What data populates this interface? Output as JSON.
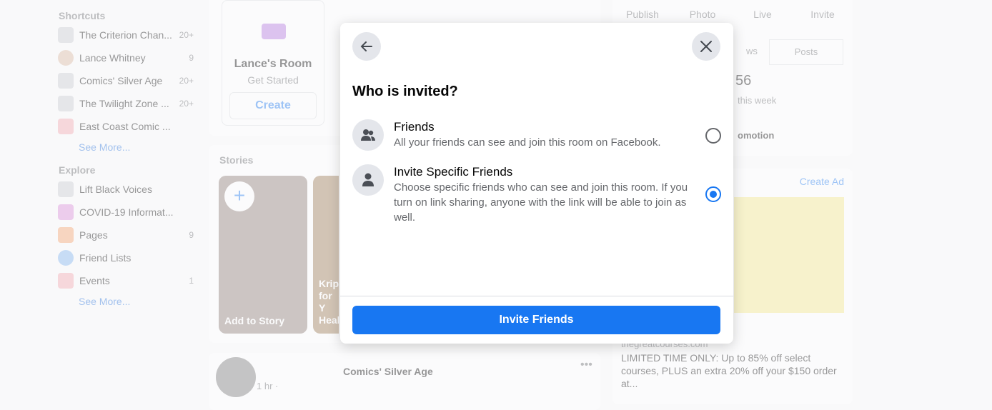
{
  "sidebar": {
    "shortcuts_heading": "Shortcuts",
    "shortcuts": [
      {
        "label": "The Criterion Chan...",
        "count": "20+"
      },
      {
        "label": "Lance Whitney",
        "count": "9"
      },
      {
        "label": "Comics' Silver Age",
        "count": "20+"
      },
      {
        "label": "The Twilight Zone ...",
        "count": "20+"
      },
      {
        "label": "East Coast Comic ...",
        "count": ""
      }
    ],
    "see_more_1": "See More...",
    "explore_heading": "Explore",
    "explore": [
      {
        "label": "Lift Black Voices",
        "count": ""
      },
      {
        "label": "COVID-19 Informat...",
        "count": ""
      },
      {
        "label": "Pages",
        "count": "9"
      },
      {
        "label": "Friend Lists",
        "count": ""
      },
      {
        "label": "Events",
        "count": "1"
      }
    ],
    "see_more_2": "See More..."
  },
  "room_card": {
    "title": "Lance's Room",
    "subtitle": "Get Started",
    "create": "Create"
  },
  "stories": {
    "heading": "Stories",
    "add": "Add to Story",
    "story2": "Krip for Y Heal"
  },
  "post": {
    "author": "Comics' Silver Age",
    "time": "1 hr ·"
  },
  "right": {
    "actions": [
      "Publish",
      "Photo",
      "Live",
      "Invite"
    ],
    "tabs": [
      "ws",
      "Posts"
    ],
    "stat": "56",
    "stat_label": "this week",
    "promotion": "omotion",
    "create_ad": "Create Ad",
    "ad_domain": "thegreatcourses.com",
    "ad_text": "LIMITED TIME ONLY: Up to 85% off select courses, PLUS an extra 20% off your $150 order at..."
  },
  "modal": {
    "title": "Who is invited?",
    "options": [
      {
        "title": "Friends",
        "desc": "All your friends can see and join this room on Facebook.",
        "selected": false
      },
      {
        "title": "Invite Specific Friends",
        "desc": "Choose specific friends who can see and join this room. If you turn on link sharing, anyone with the link will be able to join as well.",
        "selected": true
      }
    ],
    "button": "Invite Friends",
    "accent": "#1877f2"
  }
}
